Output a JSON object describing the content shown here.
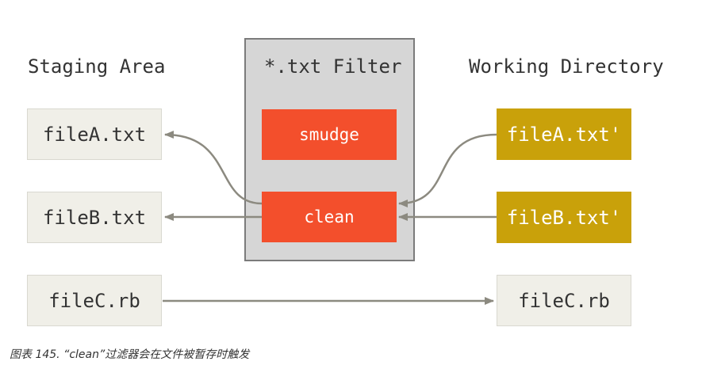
{
  "headings": {
    "staging": "Staging Area",
    "filter": "*.txt Filter",
    "working": "Working Directory"
  },
  "staging_files": [
    "fileA.txt",
    "fileB.txt",
    "fileC.rb"
  ],
  "filter_steps": [
    "smudge",
    "clean"
  ],
  "working_files": [
    "fileA.txt'",
    "fileB.txt'",
    "fileC.rb"
  ],
  "caption": "图表 145. “clean”过滤器会在文件被暂存时触发",
  "colors": {
    "gray_box": "#f0efe8",
    "gold_box": "#c9a10a",
    "red_box": "#f34f2c",
    "panel": "#d6d6d6",
    "arrow": "#8c8a80"
  }
}
